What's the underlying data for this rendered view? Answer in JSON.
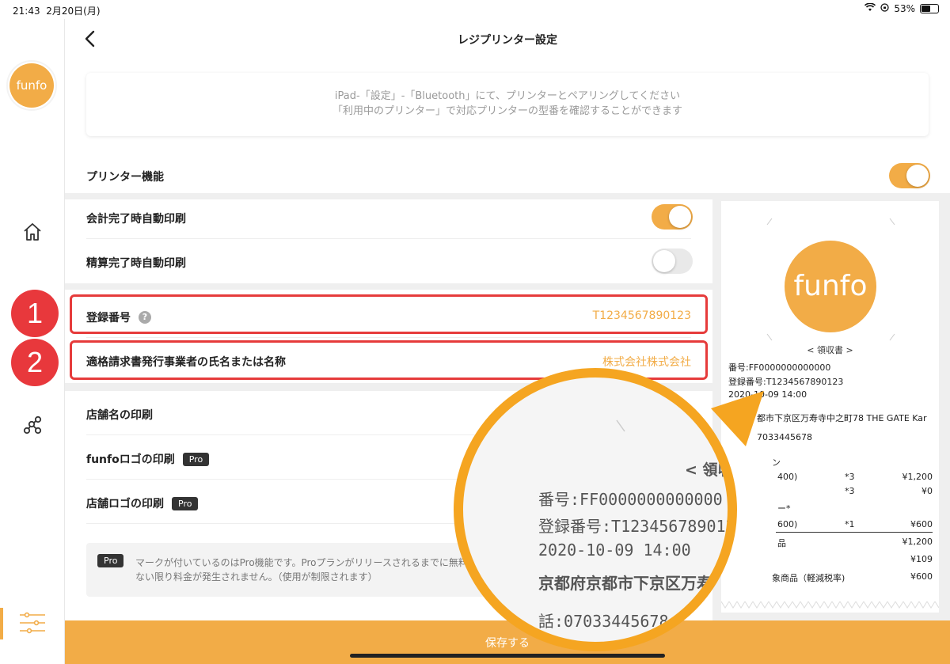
{
  "status_bar": {
    "time": "21:43",
    "date": "2月20日(月)",
    "battery": "53%"
  },
  "sidebar": {
    "logo_text": "funfo",
    "icons": [
      "home-icon",
      "network-icon",
      "settings-icon"
    ]
  },
  "header": {
    "title": "レジプリンター設定",
    "back_icon": "chevron-left-icon"
  },
  "info_box": {
    "line1": "iPad-「設定」-「Bluetooth」にて、プリンターとペアリングしてください",
    "line2": "「利用中のプリンター」で対応プリンターの型番を確認することができます"
  },
  "printer_function": {
    "label": "プリンター機能",
    "enabled": true
  },
  "auto_print": [
    {
      "label": "会計完了時自動印刷",
      "enabled": true
    },
    {
      "label": "精算完了時自動印刷",
      "enabled": false
    }
  ],
  "registration": {
    "label": "登録番号",
    "help_icon": "?",
    "value": "T1234567890123",
    "badge": "1"
  },
  "issuer": {
    "label": "適格請求書発行事業者の氏名または名称",
    "value": "株式会社株式会社",
    "badge": "2"
  },
  "print_options": [
    {
      "label": "店舗名の印刷",
      "pro": ""
    },
    {
      "label": "funfoロゴの印刷",
      "pro": "Pro"
    },
    {
      "label": "店舗ロゴの印刷",
      "pro": "Pro"
    }
  ],
  "pro_note": {
    "badge": "Pro",
    "line1": "マークが付いているのはPro機能です。Proプランがリリースされるまでに無料公",
    "line2": "ない限り料金が発生されません。（使用が制限されます）"
  },
  "receipt": {
    "logo": "funfo",
    "title": "< 領収書 >",
    "lines": [
      "番号:FF0000000000000",
      "登録番号:T1234567890123",
      "2020-10-09 14:00"
    ],
    "address": "都市下京区万寿寺中之町78 THE GATE Kar",
    "phone": "7033445678",
    "rows": [
      {
        "a": "ン",
        "b": "",
        "c": ""
      },
      {
        "a": "400)",
        "b": "*3",
        "c": "¥1,200"
      },
      {
        "a": "",
        "b": "*3",
        "c": "¥0"
      },
      {
        "a": "ー*",
        "b": "",
        "c": ""
      },
      {
        "a": "600)",
        "b": "*1",
        "c": "¥600"
      },
      {
        "a": "品",
        "b": "",
        "c": "¥1,200"
      },
      {
        "a": "",
        "b": "",
        "c": "¥109"
      },
      {
        "a": "象商品（軽減税率)",
        "b": "",
        "c": "¥600"
      }
    ]
  },
  "magnifier": {
    "title": "< 領収書",
    "number": "番号:FF0000000000000",
    "registration": "登録番号:T1234567890123",
    "datetime": "2020-10-09 14:00",
    "address": "京都府京都市下京区万寿寺中之",
    "phone": "話:07033445678"
  },
  "save_button": "保存する",
  "colors": {
    "accent": "#f2ac47",
    "highlight": "#e63b3b",
    "magnifier_ring": "#f5a521"
  }
}
